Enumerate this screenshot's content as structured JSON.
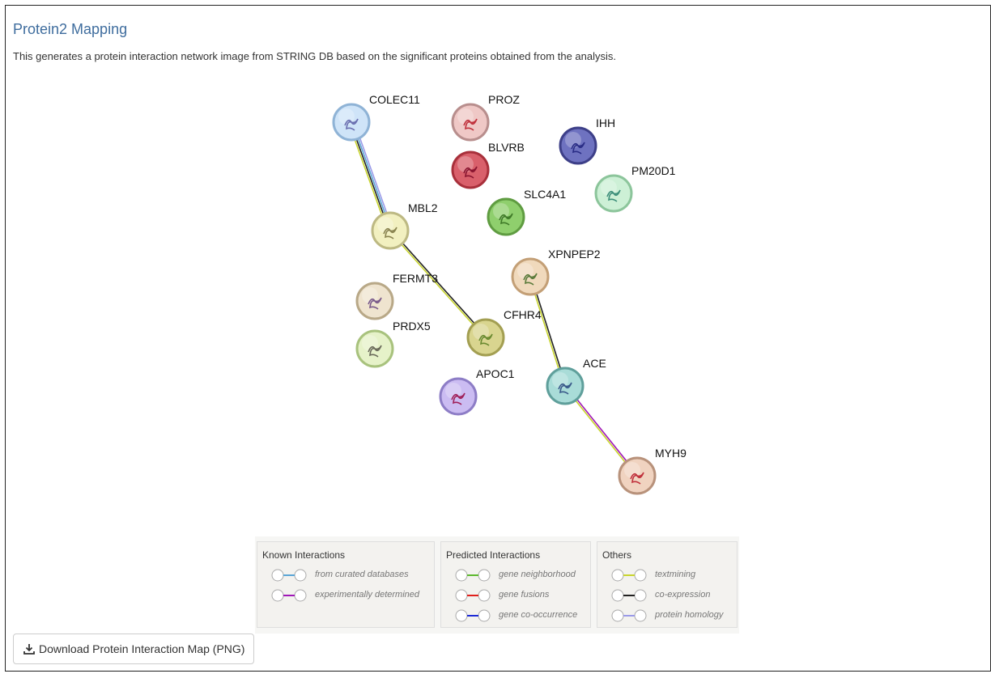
{
  "panel": {
    "title": "Protein2 Mapping",
    "description": "This generates a protein interaction network image from STRING DB based on the significant proteins obtained from the analysis."
  },
  "network": {
    "nodes": [
      {
        "id": "COLEC11",
        "label": "COLEC11",
        "color": "#cfe4f8",
        "ring": "#8fb3d6",
        "glyph": "#6a6fb0"
      },
      {
        "id": "PROZ",
        "label": "PROZ",
        "color": "#efc8c6",
        "ring": "#b88e8d",
        "glyph": "#c0303b"
      },
      {
        "id": "IHH",
        "label": "IHH",
        "color": "#6e72c0",
        "ring": "#3d3f88",
        "glyph": "#2a2d86"
      },
      {
        "id": "BLVRB",
        "label": "BLVRB",
        "color": "#d9606b",
        "ring": "#a8303b",
        "glyph": "#8a1530"
      },
      {
        "id": "PM20D1",
        "label": "PM20D1",
        "color": "#cdf0d6",
        "ring": "#8cc59b",
        "glyph": "#3d8f7a"
      },
      {
        "id": "SLC4A1",
        "label": "SLC4A1",
        "color": "#8fcf6d",
        "ring": "#5f9c41",
        "glyph": "#3f7a28"
      },
      {
        "id": "MBL2",
        "label": "MBL2",
        "color": "#f2f0c0",
        "ring": "#bdb983",
        "glyph": "#8a8450"
      },
      {
        "id": "XPNPEP2",
        "label": "XPNPEP2",
        "color": "#f0d9bc",
        "ring": "#c39f76",
        "glyph": "#5a7a3a"
      },
      {
        "id": "FERMT3",
        "label": "FERMT3",
        "color": "#efe4cf",
        "ring": "#b8a887",
        "glyph": "#7a5a8a"
      },
      {
        "id": "CFHR4",
        "label": "CFHR4",
        "color": "#d9d58f",
        "ring": "#a39f52",
        "glyph": "#6a8a30"
      },
      {
        "id": "PRDX5",
        "label": "PRDX5",
        "color": "#e6f2c9",
        "ring": "#a8c27d",
        "glyph": "#6a6a5a"
      },
      {
        "id": "ACE",
        "label": "ACE",
        "color": "#a9dcd8",
        "ring": "#5f9f9b",
        "glyph": "#3a5a8a"
      },
      {
        "id": "APOC1",
        "label": "APOC1",
        "color": "#cbbcf2",
        "ring": "#8d7dc6",
        "glyph": "#a0205a"
      },
      {
        "id": "MYH9",
        "label": "MYH9",
        "color": "#f0d3c0",
        "ring": "#b8927b",
        "glyph": "#c0303b"
      }
    ],
    "edges": [
      {
        "source": "COLEC11",
        "target": "MBL2",
        "evidence": [
          "protein homology",
          "from curated databases",
          "co-expression",
          "textmining"
        ]
      },
      {
        "source": "MBL2",
        "target": "CFHR4",
        "evidence": [
          "co-expression",
          "textmining"
        ]
      },
      {
        "source": "XPNPEP2",
        "target": "ACE",
        "evidence": [
          "co-expression",
          "textmining"
        ]
      },
      {
        "source": "ACE",
        "target": "MYH9",
        "evidence": [
          "experimentally determined",
          "textmining"
        ]
      }
    ]
  },
  "legend": {
    "known": {
      "title": "Known Interactions",
      "items": [
        {
          "label": "from curated databases",
          "color": "#5aa6d6"
        },
        {
          "label": "experimentally determined",
          "color": "#a018b8"
        }
      ]
    },
    "predicted": {
      "title": "Predicted Interactions",
      "items": [
        {
          "label": "gene neighborhood",
          "color": "#5cb82e"
        },
        {
          "label": "gene fusions",
          "color": "#e0201c"
        },
        {
          "label": "gene co-occurrence",
          "color": "#1c2ad6"
        }
      ]
    },
    "others": {
      "title": "Others",
      "items": [
        {
          "label": "textmining",
          "color": "#c8d42e"
        },
        {
          "label": "co-expression",
          "color": "#222222"
        },
        {
          "label": "protein homology",
          "color": "#9a9ae8"
        }
      ]
    }
  },
  "download_button": {
    "label": "Download Protein Interaction Map (PNG)",
    "icon": "download-icon"
  }
}
